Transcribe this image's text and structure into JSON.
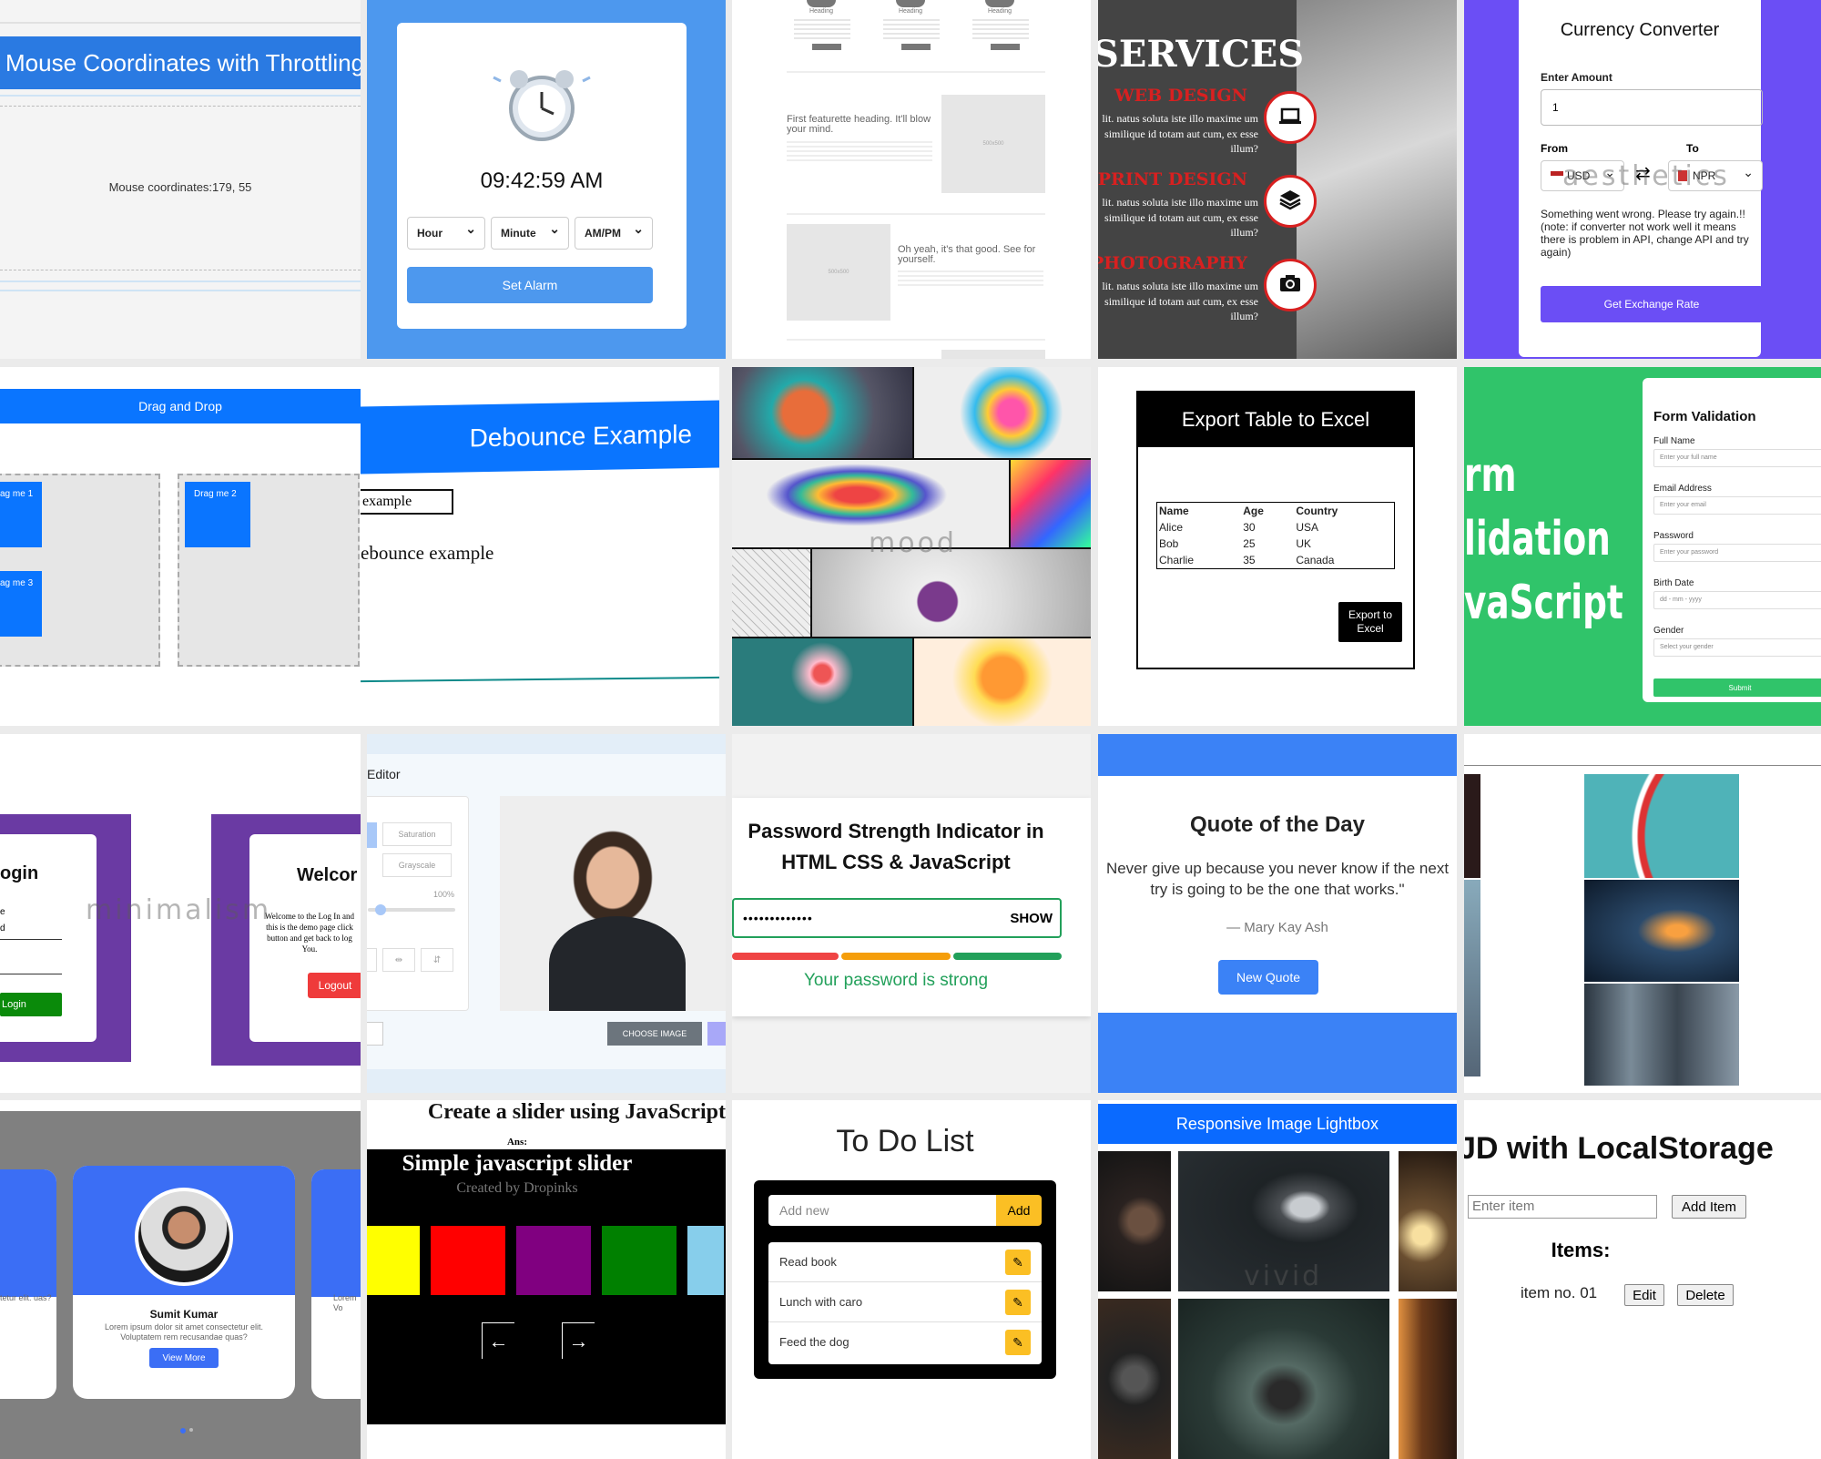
{
  "t1": {
    "title": "Mouse Coordinates with Throttling",
    "label": "Mouse coordinates:",
    "value": "179, 55"
  },
  "t2": {
    "time": "09:42:59 AM",
    "hour": "Hour",
    "minute": "Minute",
    "ampm": "AM/PM",
    "set": "Set Alarm"
  },
  "t3": {
    "heading": "Heading",
    "h1": "First featurette heading. It'll blow your mind.",
    "h2": "Oh yeah, it's that good. See for yourself.",
    "ph1": "500x500",
    "ph2": "500x500"
  },
  "t4": {
    "title": "SERVICES",
    "items": [
      {
        "name": "WEB DESIGN",
        "desc": "lit. natus soluta iste illo maxime um similique id totam aut cum, ex esse illum?"
      },
      {
        "name": "PRINT DESIGN",
        "desc": "lit. natus soluta iste illo maxime um similique id totam aut cum, ex esse illum?"
      },
      {
        "name": "PHOTOGRAPHY",
        "desc": "lit. natus soluta iste illo maxime um similique id totam aut cum, ex esse illum?"
      }
    ]
  },
  "t5": {
    "title": "Currency Converter",
    "amount_label": "Enter Amount",
    "amount": "1",
    "from_label": "From",
    "to_label": "To",
    "from": "USD",
    "to": "NPR",
    "error": "Something went wrong. Please try again.!! (note: if converter not work well it means there is problem in API, change API and try again)",
    "button": "Get Exchange Rate",
    "watermark": "aesthetics"
  },
  "t6": {
    "title": "Drag and Drop",
    "items": [
      "ag me 1",
      "ag me 3",
      "Drag me 2"
    ]
  },
  "t7": {
    "title": "Debounce Example",
    "input": "example",
    "output": "ebounce example"
  },
  "t8": {
    "watermark": "mood"
  },
  "t9": {
    "title": "Export Table to Excel",
    "headers": [
      "Name",
      "Age",
      "Country"
    ],
    "rows": [
      [
        "Alice",
        "30",
        "USA"
      ],
      [
        "Bob",
        "25",
        "UK"
      ],
      [
        "Charlie",
        "35",
        "Canada"
      ]
    ],
    "button": "Export to Excel"
  },
  "t10": {
    "side": [
      "rm",
      "lidation",
      "vaScript"
    ],
    "title": "Form Validation",
    "fields": [
      {
        "label": "Full Name",
        "ph": "Enter your full name"
      },
      {
        "label": "Email Address",
        "ph": "Enter your email"
      },
      {
        "label": "Password",
        "ph": "Enter your password"
      },
      {
        "label": "Birth Date",
        "ph": "dd - mm - yyyy"
      },
      {
        "label": "Gender",
        "ph": "Select your gender"
      }
    ],
    "submit": "Submit"
  },
  "t11": {
    "login": "ogin",
    "e": "e",
    "d": "d",
    "login_btn": "Login",
    "welcome": "Welcor",
    "text": "Welcome to the Log In and this is the demo page click button and get back to log You.",
    "logout": "Logout",
    "watermark": "minimalism"
  },
  "t12": {
    "title": "Editor",
    "saturation": "Saturation",
    "grayscale": "Grayscale",
    "pct": "100%",
    "choose": "CHOOSE IMAGE"
  },
  "t13": {
    "title": "Password Strength Indicator in HTML CSS & JavaScript",
    "password": "•••••••••••••",
    "show": "SHOW",
    "status": "Your password is strong",
    "colors": [
      "#ef4444",
      "#f59e0b",
      "#22a05a"
    ]
  },
  "t14": {
    "title": "Quote of the Day",
    "quote": "Never give up because you never know if the next try is going to be the one that works.\"",
    "author": "— Mary Kay Ash",
    "button": "New Quote"
  },
  "t16": {
    "name": "Sumit Kumar",
    "text": "Lorem ipsum dolor sit amet consectetur elit. Voluptatem rem recusandae quas?",
    "left": "tetur elit. uas?",
    "right": "Lorem Vo",
    "button": "View More"
  },
  "t17": {
    "title": "Create a slider using JavaScript",
    "ans": "Ans:",
    "heading": "Simple javascript slider",
    "sub": "Created by Dropinks",
    "colors": [
      "#ffff00",
      "#ff0000",
      "#800080",
      "#008000",
      "#87ceeb"
    ],
    "prev": "←",
    "next": "→"
  },
  "t18": {
    "title": "To Do List",
    "placeholder": "Add new",
    "add": "Add",
    "items": [
      "Read book",
      "Lunch with caro",
      "Feed the dog"
    ]
  },
  "t19": {
    "title": "Responsive Image Lightbox",
    "watermark": "vivid"
  },
  "t20": {
    "title": "JD with LocalStorage",
    "placeholder": "Enter item",
    "add": "Add Item",
    "items_label": "Items:",
    "item": "item no. 01",
    "edit": "Edit",
    "delete": "Delete"
  }
}
